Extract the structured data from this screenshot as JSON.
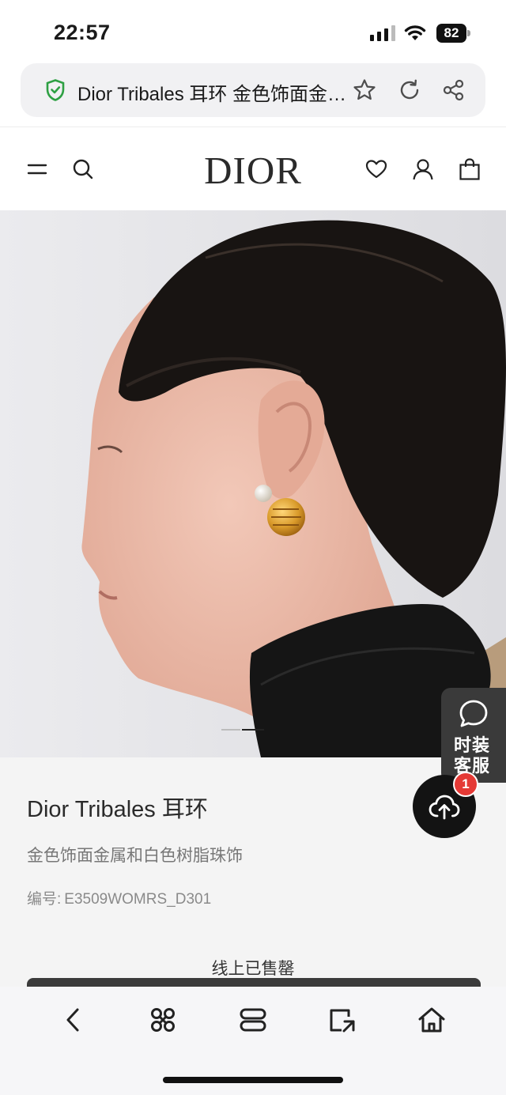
{
  "status_bar": {
    "time": "22:57",
    "battery": "82"
  },
  "browser": {
    "page_title": "Dior Tribales 耳环 金色饰面金属和白色树脂珠饰",
    "url_icons": [
      "shield-check-icon",
      "star-icon",
      "reload-icon",
      "share-icon"
    ]
  },
  "site": {
    "logo": "DIOR",
    "header_icons": [
      "menu-icon",
      "search-icon",
      "heart-icon",
      "user-icon",
      "shopping-bag-icon"
    ]
  },
  "hero": {
    "image": "model-profile-wearing-gold-earring",
    "pages": 2,
    "active_page": 2
  },
  "chat_widget": {
    "label": "时装客服"
  },
  "upload": {
    "badge": "1"
  },
  "product": {
    "name": "Dior Tribales 耳环",
    "description": "金色饰面金属和白色树脂珠饰",
    "sku_label": "编号:",
    "sku": "E3509WOMRS_D301",
    "availability": "线上已售罄"
  },
  "toolbar": {
    "icons": [
      "back-icon",
      "command-icon",
      "tabs-icon",
      "tab-switch-icon",
      "home-icon"
    ]
  },
  "colors": {
    "accent": "#111111",
    "badge": "#e53935",
    "secure": "#2ea043",
    "product_bg": "#f4f4f4"
  }
}
